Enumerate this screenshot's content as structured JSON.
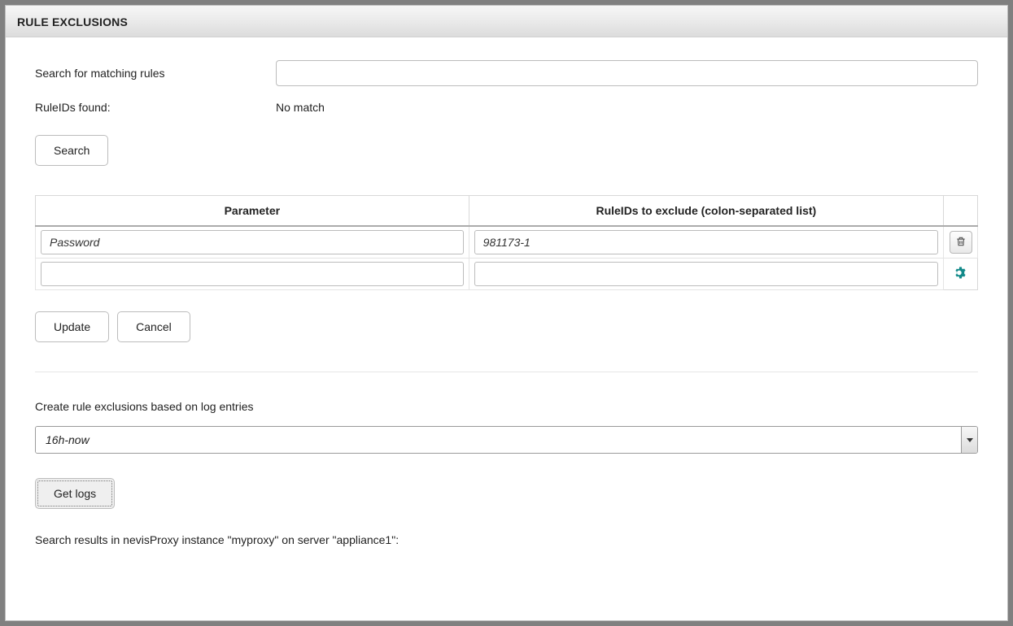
{
  "header": {
    "title": "RULE EXCLUSIONS"
  },
  "search": {
    "label": "Search for matching rules",
    "value": "",
    "found_label": "RuleIDs found:",
    "found_value": "No match",
    "button": "Search"
  },
  "table": {
    "columns": {
      "parameter": "Parameter",
      "ruleids": "RuleIDs to exclude (colon-separated list)"
    },
    "rows": [
      {
        "parameter": "Password",
        "ruleids": "981173-1",
        "tool": "trash"
      },
      {
        "parameter": "",
        "ruleids": "",
        "tool": "gear"
      }
    ]
  },
  "actions": {
    "update": "Update",
    "cancel": "Cancel"
  },
  "logs": {
    "label": "Create rule exclusions based on log entries",
    "range": "16h-now",
    "get_logs": "Get logs",
    "results_text": "Search results in nevisProxy instance \"myproxy\" on server \"appliance1\":"
  }
}
